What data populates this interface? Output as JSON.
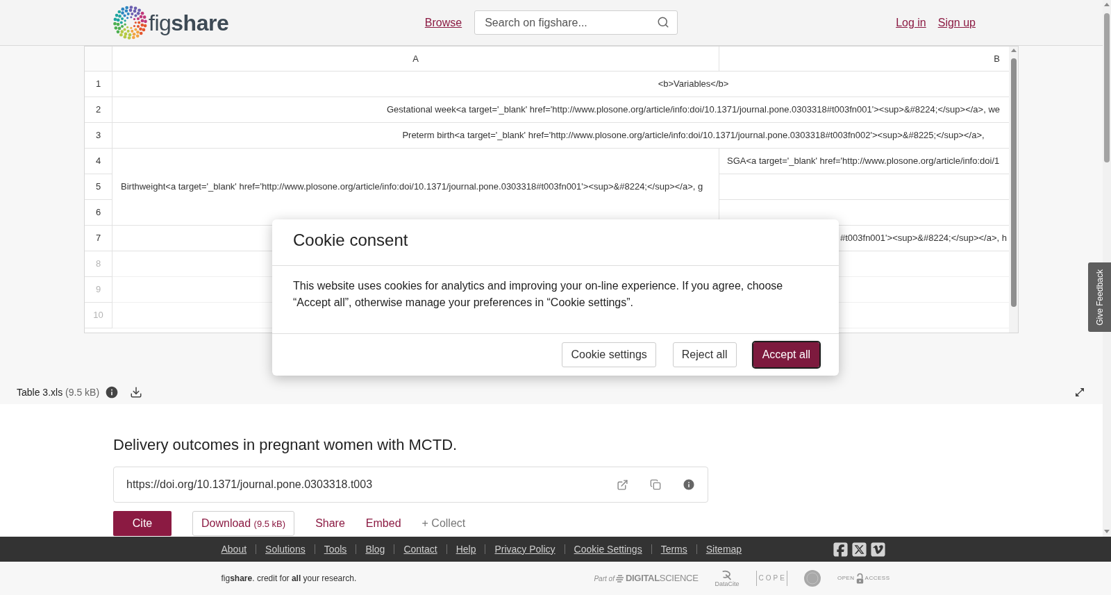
{
  "header": {
    "logo": "fig**share**",
    "nav": [
      "Browse"
    ],
    "search": {
      "placeholder": "Search on figshare..."
    },
    "auth": [
      "Log in",
      "Sign up"
    ]
  },
  "spreadsheet": {
    "columns": [
      "A",
      "B"
    ],
    "rows": [
      {
        "number": "1",
        "faded": false,
        "cells": [
          {
            "kind": "merged",
            "text": "<b>Variables</b>"
          }
        ]
      },
      {
        "number": "2",
        "faded": false,
        "cells": [
          {
            "kind": "merged",
            "text": "Gestational week<a target='_blank' href='http://www.plosone.org/article/info:doi/10.1371/journal.pone.0303318#t003fn001'><sup>&#8224;</sup></a>, we"
          }
        ]
      },
      {
        "number": "3",
        "faded": false,
        "cells": [
          {
            "kind": "merged",
            "text": "Preterm birth<a target='_blank' href='http://www.plosone.org/article/info:doi/10.1371/journal.pone.0303318#t003fn002'><sup>&#8225;</sup></a>,"
          }
        ]
      },
      {
        "number": "4",
        "faded": false,
        "cells": [
          {
            "kind": "tall",
            "text": "Birthweight<a target='_blank' href='http://www.plosone.org/article/info:doi/10.1371/journal.pone.0303318#t003fn001'><sup>&#8224;</sup></a>, g"
          },
          {
            "kind": "plain",
            "text": "SGA<a target='_blank' href='http://www.plosone.org/article/info:doi/1"
          }
        ]
      },
      {
        "number": "5",
        "faded": false,
        "cells": [
          {
            "kind": "plain"
          }
        ]
      },
      {
        "number": "6",
        "faded": false,
        "cells": [
          {
            "kind": "plain"
          }
        ]
      },
      {
        "number": "7",
        "faded": false,
        "cells": [
          {
            "kind": "tail",
            "text": "#t003fn001'><sup>&#8224;</sup></a>, h"
          }
        ]
      },
      {
        "number": "8",
        "faded": true
      },
      {
        "number": "9",
        "faded": true
      },
      {
        "number": "10",
        "faded": true
      }
    ]
  },
  "file_bar": {
    "name": "Table 3.xls",
    "size": "(9.5 kB)"
  },
  "feedback_tab": {
    "label": "Give Feedback"
  },
  "item": {
    "title": "Delivery outcomes in pregnant women with MCTD.",
    "doi": "https://doi.org/10.1371/journal.pone.0303318.t003",
    "actions": [
      {
        "kind": "primary",
        "label": "Cite"
      },
      {
        "kind": "outline",
        "label": "Download",
        "note": "(9.5 kB)"
      },
      {
        "kind": "link",
        "label": "Share"
      },
      {
        "kind": "link",
        "label": "Embed"
      },
      {
        "kind": "muted",
        "label": "+ Collect"
      }
    ]
  },
  "footer": {
    "links": [
      "About",
      "Solutions",
      "Tools",
      "Blog",
      "Contact",
      "Help",
      "Privacy Policy",
      "Cookie Settings",
      "Terms",
      "Sitemap"
    ],
    "social": [
      {
        "kind": "facebook"
      },
      {
        "kind": "x"
      },
      {
        "kind": "vimeo"
      }
    ],
    "tagline": "fig**share**. credit for **all** your research.",
    "partners": [
      {
        "kind": "digital_science",
        "prefix": "Part of",
        "name": "DIGITAL",
        "suffix": "SCIENCE"
      },
      {
        "kind": "datacite",
        "name": "DataCite"
      },
      {
        "kind": "cope",
        "name": "COPE"
      },
      {
        "kind": "seal"
      },
      {
        "kind": "open_access",
        "name": "OPEN",
        "suffix": "ACCESS"
      }
    ]
  },
  "cookie_dialog": {
    "title": "Cookie consent",
    "message": "This website uses cookies for analytics and improving your on-line experience. If you agree, choose “Accept all”, otherwise manage your preferences in “Cookie settings”.",
    "buttons": [
      {
        "kind": "secondary",
        "label": "Cookie settings",
        "focused": false
      },
      {
        "kind": "secondary",
        "label": "Reject all",
        "focused": false
      },
      {
        "kind": "primary",
        "label": "Accept all",
        "focused": true
      }
    ]
  }
}
